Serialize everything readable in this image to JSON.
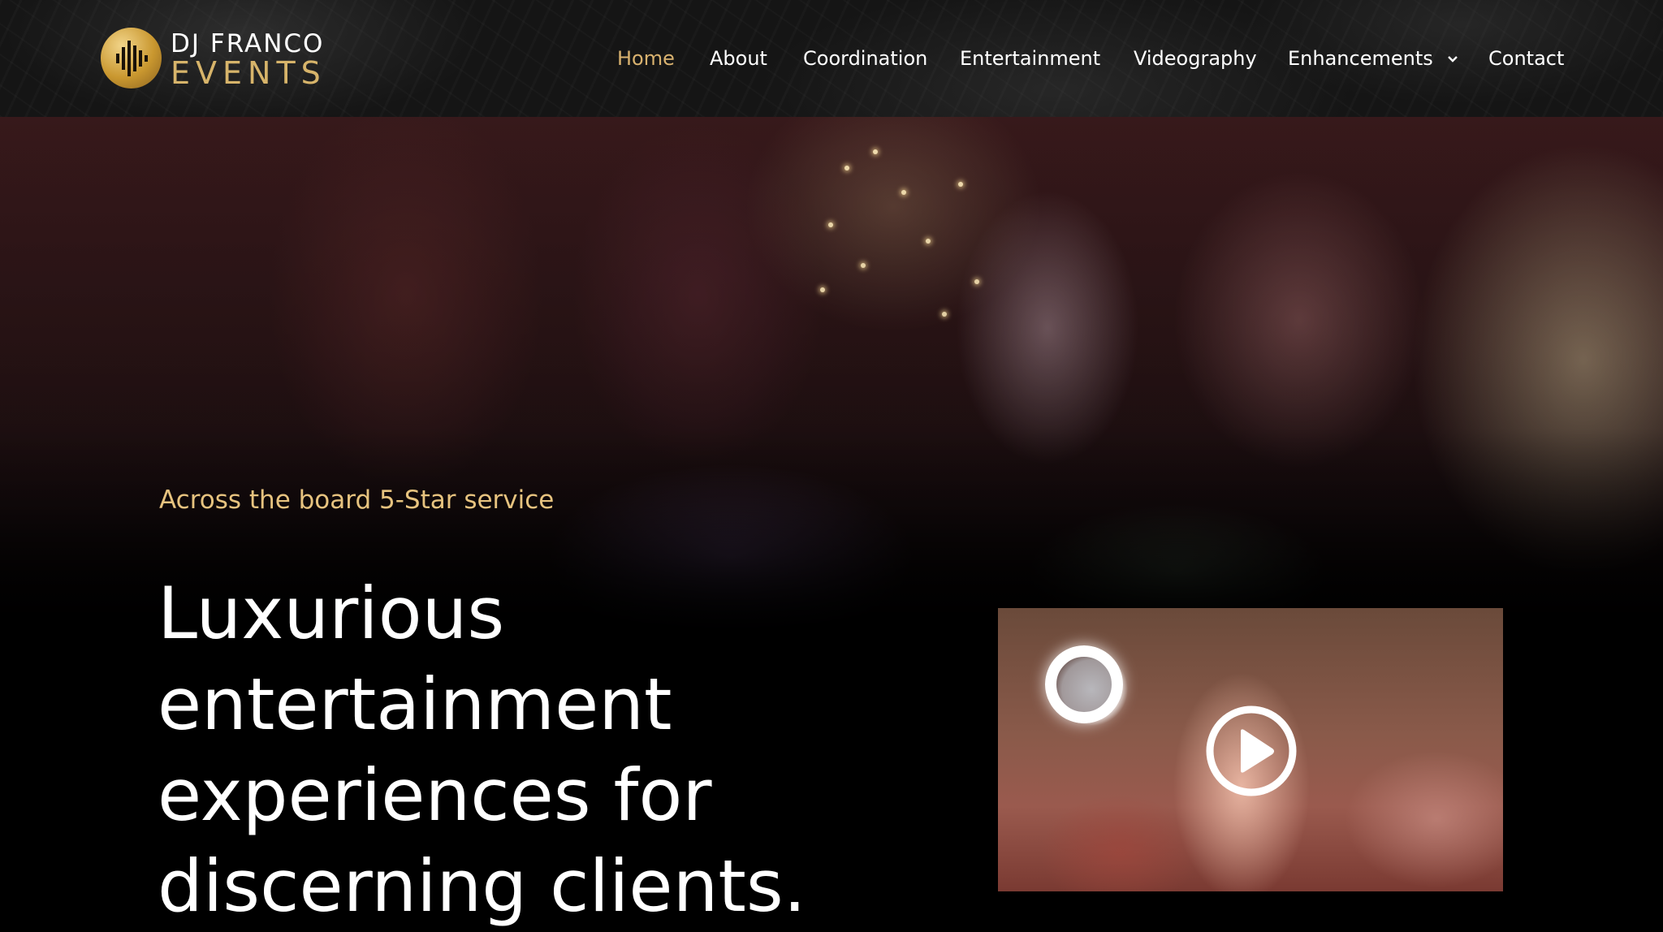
{
  "header": {
    "logo": {
      "line1": "DJ FRANCO",
      "line2": "EVENTS"
    },
    "nav": [
      {
        "label": "Home",
        "active": true
      },
      {
        "label": "About"
      },
      {
        "label": "Coordination"
      },
      {
        "label": "Entertainment"
      },
      {
        "label": "Videography"
      },
      {
        "label": "Enhancements",
        "has_dropdown": true
      },
      {
        "label": "Contact"
      }
    ]
  },
  "hero": {
    "tagline": "Across the board 5-Star service",
    "headline_lines": [
      "Luxurious",
      "entertainment",
      "experiences for",
      "discerning clients."
    ]
  },
  "video": {
    "play_icon": "play-icon"
  },
  "colors": {
    "accent_gold": "#d9b26f",
    "tagline_gold": "#e7c37f",
    "background": "#000000"
  }
}
